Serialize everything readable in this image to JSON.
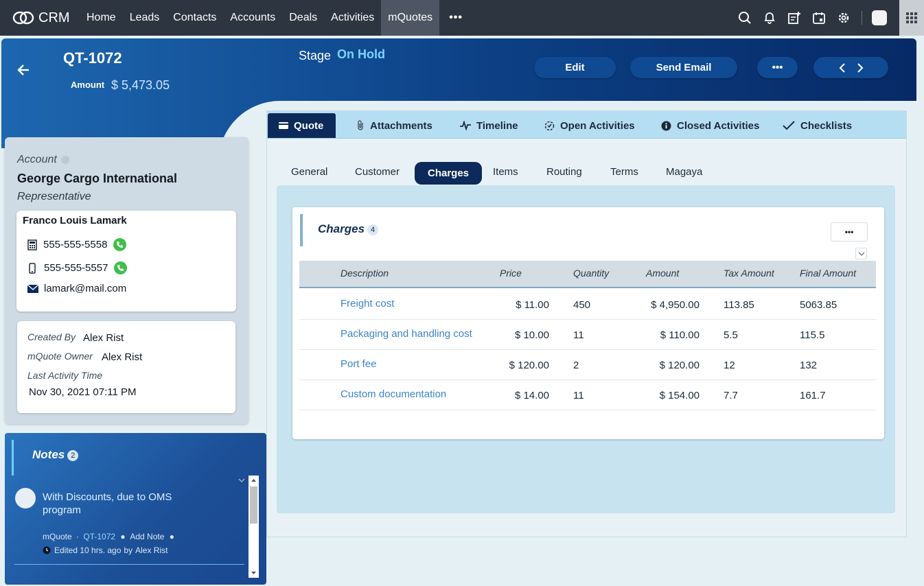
{
  "topbar": {
    "app_name": "CRM",
    "nav": [
      "Home",
      "Leads",
      "Contacts",
      "Accounts",
      "Deals",
      "Activities",
      "mQuotes"
    ],
    "active_nav": "mQuotes",
    "more": "•••"
  },
  "header": {
    "quote_id": "QT-1072",
    "amount_label": "Amount",
    "amount_value": "$ 5,473.05",
    "stage_label": "Stage",
    "stage_value": "On Hold",
    "edit_label": "Edit",
    "send_email_label": "Send Email",
    "more_label": "•••"
  },
  "account": {
    "label": "Account",
    "name": "George Cargo International",
    "rep_label": "Representative",
    "contact_name": "Franco Louis Lamark",
    "phone": "555-555-5558",
    "mobile": "555-555-5557",
    "email": "lamark@mail.com"
  },
  "meta": {
    "created_by_label": "Created By",
    "created_by": "Alex Rist",
    "owner_label": "mQuote Owner",
    "owner": "Alex Rist",
    "last_activity_label": "Last Activity Time",
    "last_activity": "Nov 30, 2021 07:11 PM"
  },
  "notes": {
    "title": "Notes",
    "count": "2",
    "items": [
      {
        "text": "With Discounts, due to OMS program",
        "module": "mQuote",
        "sep1": "·",
        "record": "QT-1072",
        "action": "Add Note",
        "edited": "Edited 10 hrs. ago",
        "by_label": "by",
        "author": "Alex Rist"
      }
    ]
  },
  "tabs": [
    "Quote",
    "Attachments",
    "Timeline",
    "Open Activities",
    "Closed Activities",
    "Checklists"
  ],
  "active_tab": "Quote",
  "subtabs": [
    "General",
    "Customer",
    "Charges",
    "Items",
    "Routing",
    "Terms",
    "Magaya"
  ],
  "active_subtab": "Charges",
  "charges": {
    "title": "Charges",
    "count": "4",
    "more_label": "•••",
    "columns": [
      "Description",
      "Price",
      "Quantity",
      "Amount",
      "Tax Amount",
      "Final Amount"
    ],
    "rows": [
      {
        "description": "Freight cost",
        "price": "$ 11.00",
        "quantity": "450",
        "amount": "$ 4,950.00",
        "tax": "113.85",
        "final": "5063.85"
      },
      {
        "description": "Packaging and handling cost",
        "price": "$ 10.00",
        "quantity": "11",
        "amount": "$ 110.00",
        "tax": "5.5",
        "final": "115.5"
      },
      {
        "description": "Port fee",
        "price": "$ 120.00",
        "quantity": "2",
        "amount": "$ 120.00",
        "tax": "12",
        "final": "132"
      },
      {
        "description": "Custom documentation",
        "price": "$ 14.00",
        "quantity": "11",
        "amount": "$ 154.00",
        "tax": "7.7",
        "final": "161.7"
      }
    ]
  }
}
